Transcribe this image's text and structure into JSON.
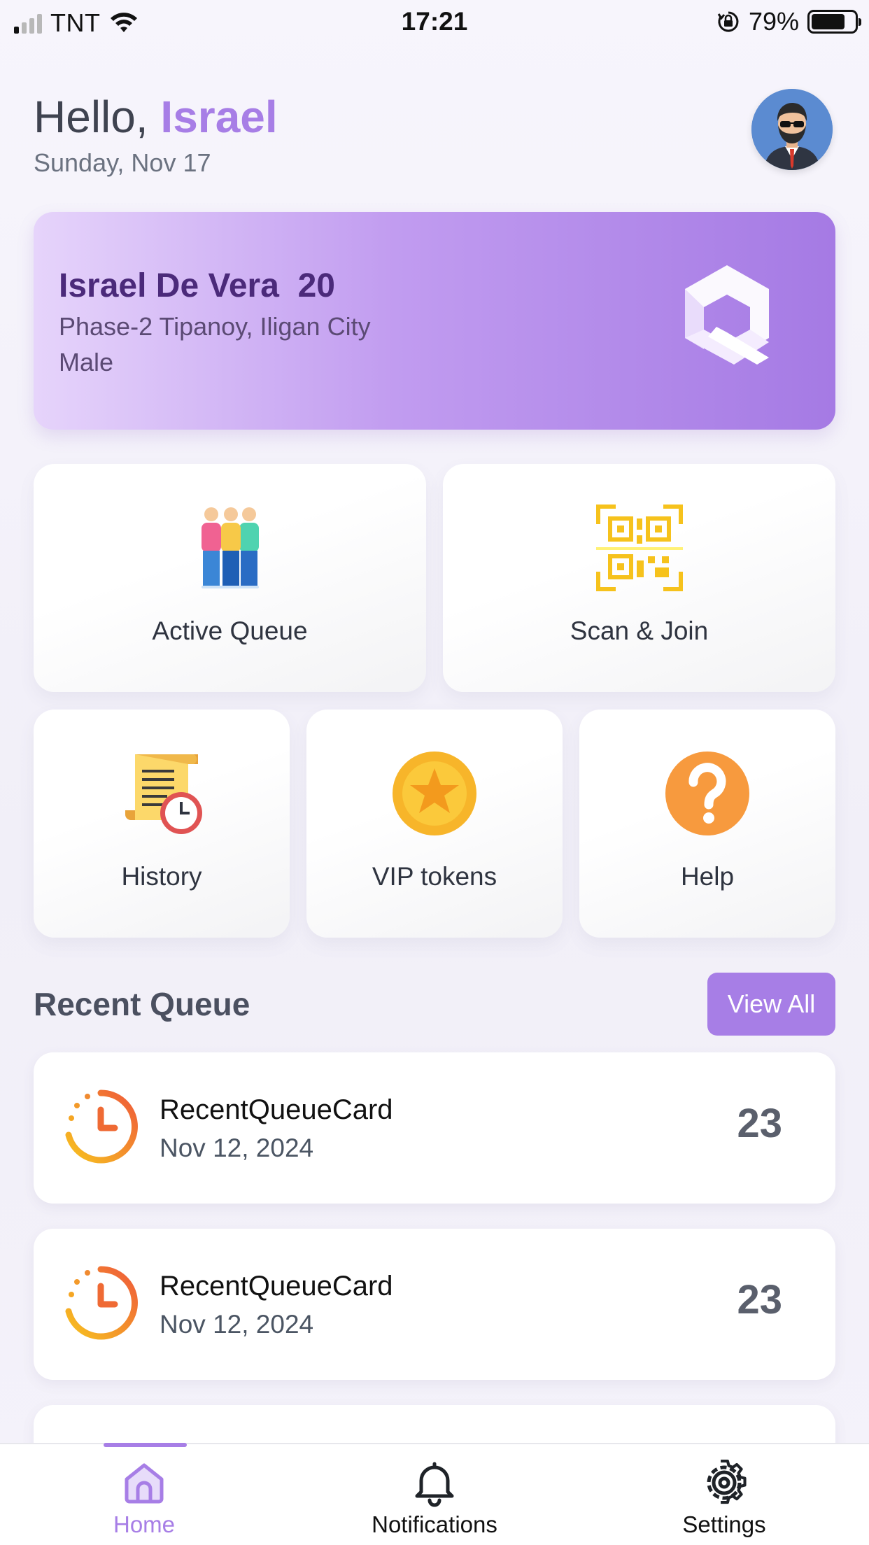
{
  "status_bar": {
    "carrier": "TNT",
    "time": "17:21",
    "battery": "79%",
    "battery_level": 0.79
  },
  "header": {
    "greeting_prefix": "Hello, ",
    "user_name": "Israel",
    "date": "Sunday, Nov 17",
    "avatar_icon": "user-avatar-icon"
  },
  "profile_card": {
    "full_name": "Israel De Vera",
    "age": "20",
    "address": "Phase-2 Tipanoy, Iligan City",
    "gender": "Male",
    "logo_icon": "app-logo-icon"
  },
  "tiles": {
    "active_queue": {
      "label": "Active Queue",
      "icon": "people-queue-icon"
    },
    "scan_join": {
      "label": "Scan & Join",
      "icon": "qr-code-icon"
    },
    "history": {
      "label": "History",
      "icon": "history-scroll-icon"
    },
    "vip_tokens": {
      "label": "VIP tokens",
      "icon": "star-coin-icon"
    },
    "help": {
      "label": "Help",
      "icon": "question-mark-icon"
    }
  },
  "recent_queue": {
    "title": "Recent Queue",
    "view_all_label": "View All",
    "items": [
      {
        "title": "RecentQueueCard",
        "date": "Nov 12, 2024",
        "number": "23",
        "icon": "clock-icon"
      },
      {
        "title": "RecentQueueCard",
        "date": "Nov 12, 2024",
        "number": "23",
        "icon": "clock-icon"
      }
    ]
  },
  "bottom_nav": {
    "items": [
      {
        "label": "Home",
        "icon": "home-icon",
        "active": true
      },
      {
        "label": "Notifications",
        "icon": "bell-icon",
        "active": false
      },
      {
        "label": "Settings",
        "icon": "gear-icon",
        "active": false
      }
    ]
  },
  "colors": {
    "accent": "#a77ee6",
    "profile_name": "#4b2a7a",
    "background": "#f5f3fb"
  }
}
